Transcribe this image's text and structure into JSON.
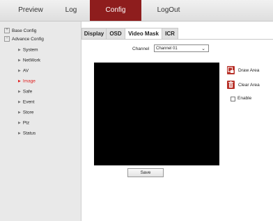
{
  "nav": {
    "preview": "Preview",
    "log": "Log",
    "config": "Config",
    "logout": "LogOut"
  },
  "sidebar": {
    "base_config": "Base Config",
    "advance_config": "Advance Config",
    "items": [
      {
        "label": "System"
      },
      {
        "label": "NetWork"
      },
      {
        "label": "AV"
      },
      {
        "label": "Image"
      },
      {
        "label": "Safe"
      },
      {
        "label": "Event"
      },
      {
        "label": "Store"
      },
      {
        "label": "Ptz"
      },
      {
        "label": "Status"
      }
    ],
    "selected": "Image"
  },
  "tabs": [
    "Display",
    "OSD",
    "Video Mask",
    "ICR"
  ],
  "active_tab": "Video Mask",
  "channel": {
    "label": "Channel",
    "value": "Channel 01"
  },
  "actions": {
    "draw_area": "Draw Area",
    "clear_area": "Clear Area",
    "enable": "Enable"
  },
  "save_label": "Save",
  "colors": {
    "accent": "#8e1d1d",
    "selected_text": "#e02020",
    "icon": "#b8322a"
  }
}
